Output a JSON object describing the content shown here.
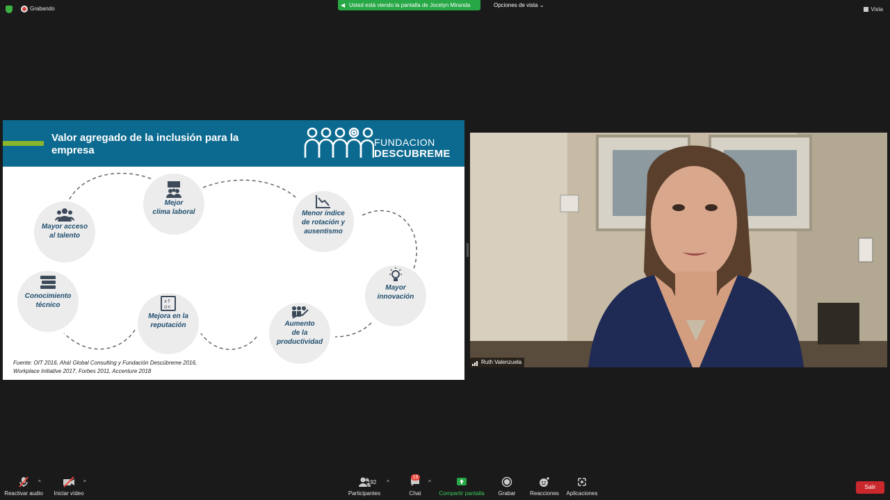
{
  "topbar": {
    "recording_label": "Grabando",
    "viewing_banner": "Usted está viendo la pantalla de Jocelyn Miranda",
    "view_options": "Opciones de vista",
    "view_button": "Vista"
  },
  "slide": {
    "title": "Valor agregado de la inclusión para la empresa",
    "logo_line1": "FUNDACION",
    "logo_line2": "DESCUBREME",
    "items": [
      {
        "label": "Mejor\nclima laboral",
        "icon": "team-presentation-icon"
      },
      {
        "label": "Menor índice\nde rotación y\nausentismo",
        "icon": "declining-chart-icon"
      },
      {
        "label": "Mayor acceso\nal talento",
        "icon": "people-group-icon"
      },
      {
        "label": "Mayor\ninnovación",
        "icon": "lightbulb-icon"
      },
      {
        "label": "Conocimiento\ntécnico",
        "icon": "books-icon"
      },
      {
        "label": "Mejora en la\nreputación",
        "icon": "strategy-board-icon"
      },
      {
        "label": "Aumento\nde la\nproductividad",
        "icon": "growth-team-icon"
      }
    ],
    "source": "Fuente: OIT 2016, Ahá! Global Consulting y Fundación Descúbreme 2016,\nWorkplace Initiative 2017, Forbes 2011, Accenture 2018"
  },
  "video": {
    "participant_name": "Ruth Valenzuela"
  },
  "toolbar": {
    "audio_label": "Reactivar audio",
    "video_label": "Iniciar vídeo",
    "participants_label": "Participantes",
    "participants_count": "192",
    "chat_label": "Chat",
    "chat_badge": "19",
    "share_label": "Compartir pantalla",
    "record_label": "Grabar",
    "reactions_label": "Reacciones",
    "apps_label": "Aplicaciones",
    "leave_label": "Salir"
  },
  "colors": {
    "slide_header": "#0c6a90",
    "accent_green": "#8bb52a",
    "share_green": "#27a745",
    "leave_red": "#c9282d"
  }
}
